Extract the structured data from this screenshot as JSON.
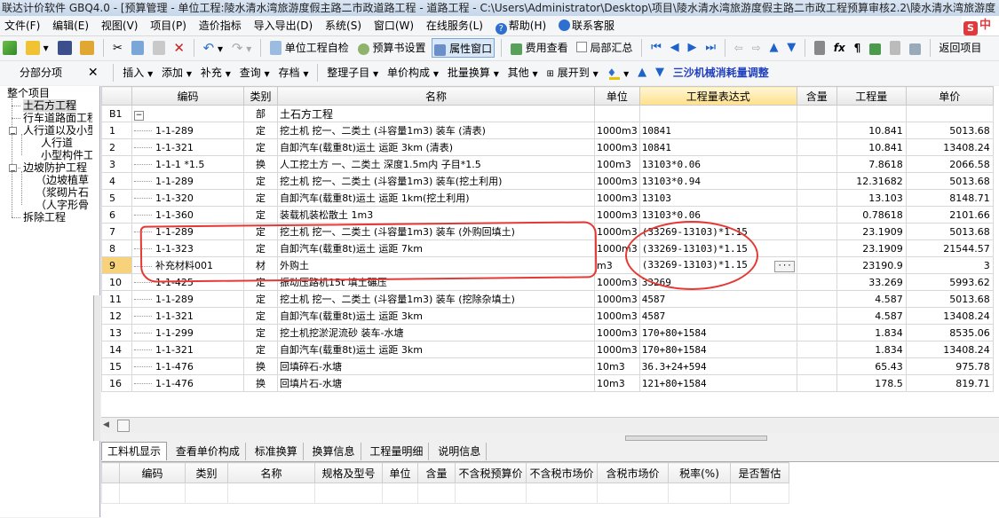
{
  "window": {
    "title": "联达计价软件 GBQ4.0 - [预算管理 - 单位工程:陵水清水湾旅游度假主路二市政道路工程 - 道路工程 - C:\\Users\\Administrator\\Desktop\\项目\\陵水清水湾旅游度假主路二市政工程预算审核2.2\\陵水清水湾旅游度"
  },
  "menu": [
    "文件(F)",
    "编辑(E)",
    "视图(V)",
    "项目(P)",
    "造价指标",
    "导入导出(D)",
    "系统(S)",
    "窗口(W)",
    "在线服务(L)",
    "帮助(H)",
    "联系客服"
  ],
  "logo_text": "中",
  "toolbar1": {
    "unit_check": "单位工程自检",
    "budget_setting": "预算书设置",
    "property_window": "属性窗口",
    "fee_view": "费用查看",
    "local_summary": "局部汇总",
    "return_item": "返回项目"
  },
  "toolbar2": {
    "panel_label": "分部分项",
    "close_glyph": "✕",
    "insert": "插入",
    "add": "添加",
    "supplement": "补充",
    "query": "查询",
    "storage": "存档",
    "organize": "整理子目",
    "unit_price_comp": "单价构成",
    "batch_convert": "批量换算",
    "other": "其他",
    "expand_to": "展开到",
    "sansha": "三沙机械消耗量调整"
  },
  "tree": {
    "items": [
      {
        "label": "整个项目"
      },
      {
        "label": "土石方工程"
      },
      {
        "label": "行车道路面工程"
      },
      {
        "label": "人行道以及小型"
      },
      {
        "label": "人行道"
      },
      {
        "label": "小型构件工"
      },
      {
        "label": "边坡防护工程"
      },
      {
        "label": "（边坡植草"
      },
      {
        "label": "（浆砌片石"
      },
      {
        "label": "（人字形骨"
      },
      {
        "label": "拆除工程"
      }
    ]
  },
  "grid": {
    "headers": {
      "code": "编码",
      "type": "类别",
      "name": "名称",
      "unit": "单位",
      "expr": "工程量表达式",
      "content": "含量",
      "qty": "工程量",
      "price": "单价"
    },
    "section": {
      "idx": "B1",
      "minus": "−",
      "type": "部",
      "name": "土石方工程"
    },
    "rows": [
      {
        "idx": "1",
        "code": "1-1-289",
        "type": "定",
        "name": "挖土机 挖一、二类土 (斗容量1m3) 装车 (清表)",
        "unit": "1000m3",
        "expr": "10841",
        "qty": "10.841",
        "price": "5013.68"
      },
      {
        "idx": "2",
        "code": "1-1-321",
        "type": "定",
        "name": "自卸汽车(载重8t)运土 运距 3km (清表)",
        "unit": "1000m3",
        "expr": "10841",
        "qty": "10.841",
        "price": "13408.24"
      },
      {
        "idx": "3",
        "code": "1-1-1 *1.5",
        "type": "换",
        "name": "人工挖土方 一、二类土 深度1.5m内 子目*1.5",
        "unit": "100m3",
        "expr": "13103*0.06",
        "qty": "7.8618",
        "price": "2066.58"
      },
      {
        "idx": "4",
        "code": "1-1-289",
        "type": "定",
        "name": "挖土机 挖一、二类土 (斗容量1m3) 装车(挖土利用)",
        "unit": "1000m3",
        "expr": "13103*0.94",
        "qty": "12.31682",
        "price": "5013.68"
      },
      {
        "idx": "5",
        "code": "1-1-320",
        "type": "定",
        "name": "自卸汽车(载重8t)运土 运距 1km(挖土利用)",
        "unit": "1000m3",
        "expr": "13103",
        "qty": "13.103",
        "price": "8148.71"
      },
      {
        "idx": "6",
        "code": "1-1-360",
        "type": "定",
        "name": "装载机装松散土 1m3",
        "unit": "1000m3",
        "expr": "13103*0.06",
        "qty": "0.78618",
        "price": "2101.66"
      },
      {
        "idx": "7",
        "code": "1-1-289",
        "type": "定",
        "name": "挖土机 挖一、二类土 (斗容量1m3) 装车 (外购回填土)",
        "unit": "1000m3",
        "expr": "(33269-13103)*1.15",
        "qty": "23.1909",
        "price": "5013.68"
      },
      {
        "idx": "8",
        "code": "1-1-323",
        "type": "定",
        "name": "自卸汽车(载重8t)运土 运距 7km",
        "unit": "1000m3",
        "expr": "(33269-13103)*1.15",
        "qty": "23.1909",
        "price": "21544.57"
      },
      {
        "idx": "9",
        "code": "补充材料001",
        "type": "材",
        "name": "外购土",
        "unit": "m3",
        "expr": "(33269-13103)*1.15",
        "qty": "23190.9",
        "price": "3",
        "active": true
      },
      {
        "idx": "10",
        "code": "1-1-425",
        "type": "定",
        "name": "振动压路机15t 填土碾压",
        "unit": "1000m3",
        "expr": "33269",
        "qty": "33.269",
        "price": "5993.62"
      },
      {
        "idx": "11",
        "code": "1-1-289",
        "type": "定",
        "name": "挖土机 挖一、二类土 (斗容量1m3) 装车 (挖除杂填土)",
        "unit": "1000m3",
        "expr": "4587",
        "qty": "4.587",
        "price": "5013.68"
      },
      {
        "idx": "12",
        "code": "1-1-321",
        "type": "定",
        "name": "自卸汽车(载重8t)运土 运距 3km",
        "unit": "1000m3",
        "expr": "4587",
        "qty": "4.587",
        "price": "13408.24"
      },
      {
        "idx": "13",
        "code": "1-1-299",
        "type": "定",
        "name": "挖土机挖淤泥流砂 装车-水塘",
        "unit": "1000m3",
        "expr": "170+80+1584",
        "qty": "1.834",
        "price": "8535.06"
      },
      {
        "idx": "14",
        "code": "1-1-321",
        "type": "定",
        "name": "自卸汽车(载重8t)运土 运距 3km",
        "unit": "1000m3",
        "expr": "170+80+1584",
        "qty": "1.834",
        "price": "13408.24"
      },
      {
        "idx": "15",
        "code": "1-1-476",
        "type": "换",
        "name": "回填碎石-水塘",
        "unit": "10m3",
        "expr": "36.3+24+594",
        "qty": "65.43",
        "price": "975.78"
      },
      {
        "idx": "16",
        "code": "1-1-476",
        "type": "换",
        "name": "回填片石-水塘",
        "unit": "10m3",
        "expr": "121+80+1584",
        "qty": "178.5",
        "price": "819.71"
      }
    ],
    "ellipsis": "···"
  },
  "bottom_tabs": [
    "工料机显示",
    "查看单价构成",
    "标准换算",
    "换算信息",
    "工程量明细",
    "说明信息"
  ],
  "bottom_headers": [
    "编码",
    "类别",
    "名称",
    "规格及型号",
    "单位",
    "含量",
    "不含税预算价",
    "不含税市场价",
    "含税市场价",
    "税率(%)",
    "是否暂估"
  ]
}
